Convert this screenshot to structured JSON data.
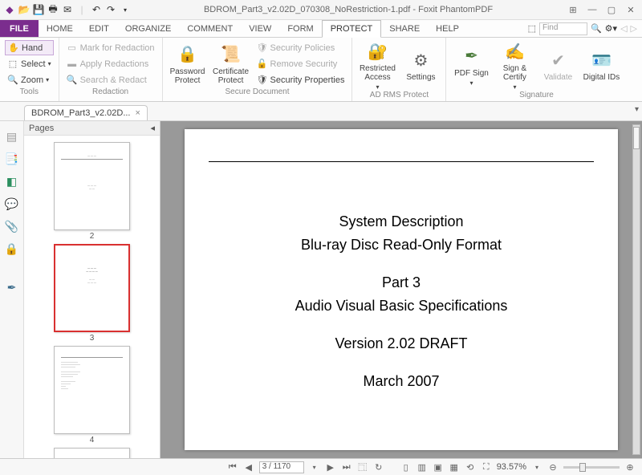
{
  "title": "BDROM_Part3_v2.02D_070308_NoRestriction-1.pdf - Foxit PhantomPDF",
  "menu": {
    "file": "FILE",
    "tabs": [
      "HOME",
      "EDIT",
      "ORGANIZE",
      "COMMENT",
      "VIEW",
      "FORM",
      "PROTECT",
      "SHARE",
      "HELP"
    ],
    "active": "PROTECT"
  },
  "search": {
    "placeholder": "Find"
  },
  "ribbon": {
    "tools": {
      "label": "Tools",
      "hand": "Hand",
      "select": "Select",
      "zoom": "Zoom"
    },
    "redaction": {
      "label": "Redaction",
      "mark": "Mark for Redaction",
      "apply": "Apply Redactions",
      "search": "Search & Redact"
    },
    "secdoc": {
      "label": "Secure Document",
      "password": "Password Protect",
      "cert": "Certificate Protect",
      "policies": "Security Policies",
      "remove": "Remove Security",
      "props": "Security Properties"
    },
    "rms": {
      "label": "AD RMS Protect",
      "restricted": "Restricted Access",
      "settings": "Settings"
    },
    "sig": {
      "label": "Signature",
      "pdfsign": "PDF Sign",
      "signcert": "Sign & Certify",
      "validate": "Validate",
      "ids": "Digital IDs"
    }
  },
  "doctab": {
    "name": "BDROM_Part3_v2.02D..."
  },
  "pagesPanel": {
    "title": "Pages"
  },
  "thumbs": {
    "p2": "2",
    "p3": "3",
    "p4": "4",
    "selected": 3
  },
  "document": {
    "l1": "System Description",
    "l2": "Blu-ray Disc Read-Only Format",
    "l3": "Part 3",
    "l4": "Audio Visual Basic Specifications",
    "l5": "Version 2.02 DRAFT",
    "l6": "March 2007"
  },
  "status": {
    "page": "3 / 1170",
    "zoom": "93.57%"
  }
}
